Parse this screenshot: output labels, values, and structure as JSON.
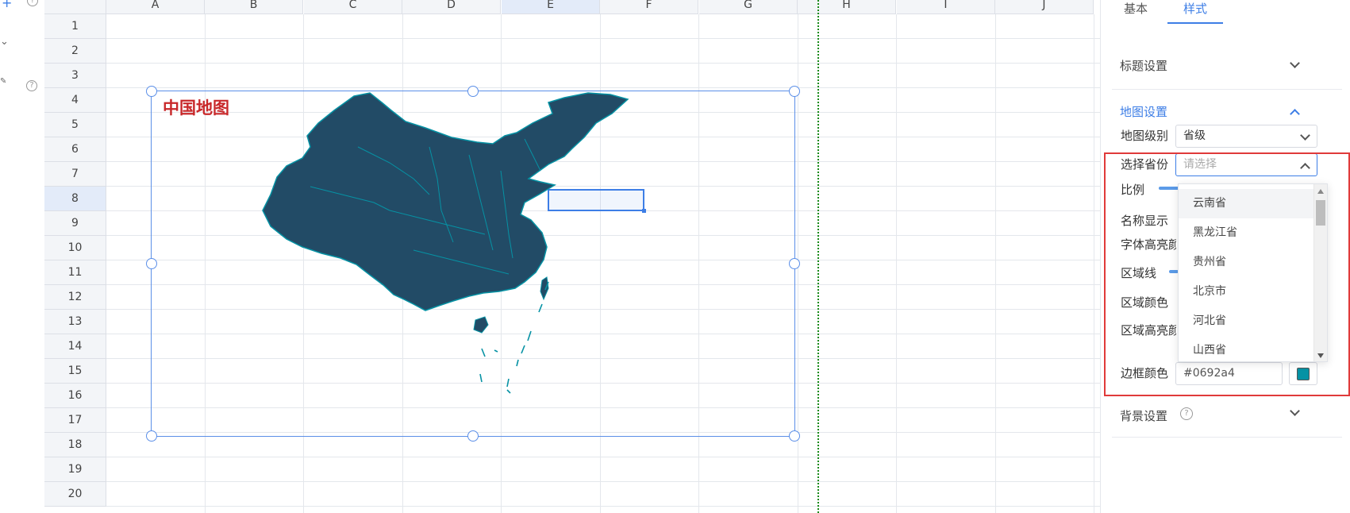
{
  "sheet": {
    "columns": [
      "A",
      "B",
      "C",
      "D",
      "E",
      "F",
      "G",
      "H",
      "I",
      "J"
    ],
    "rows": [
      "1",
      "2",
      "3",
      "4",
      "5",
      "6",
      "7",
      "8",
      "9",
      "10",
      "11",
      "12",
      "13",
      "14",
      "15",
      "16",
      "17",
      "18",
      "19",
      "20"
    ],
    "selected_column": "E",
    "selected_row": "8"
  },
  "chart": {
    "title": "中国地图",
    "fill_color": "#224b66",
    "border_color": "#0692a4"
  },
  "panel": {
    "tabs": [
      {
        "label": "基本",
        "active": false
      },
      {
        "label": "样式",
        "active": true
      }
    ],
    "sections": {
      "title_settings": "标题设置",
      "map_settings": "地图设置",
      "background_settings": "背景设置"
    },
    "fields": {
      "map_level_label": "地图级别",
      "map_level_value": "省级",
      "province_label": "选择省份",
      "province_placeholder": "请选择",
      "scale_label": "比例",
      "name_display_label": "名称显示",
      "font_highlight_label": "字体高亮颜",
      "region_line_label": "区域线",
      "region_color_label": "区域颜色",
      "region_highlight_label": "区域高亮颜",
      "border_color_label": "边框颜色",
      "border_color_value": "#0692a4"
    },
    "province_options": [
      "云南省",
      "黑龙江省",
      "贵州省",
      "北京市",
      "河北省",
      "山西省"
    ],
    "hovered_option": "云南省",
    "accent_color": "#3d7ee6",
    "highlight_box_color": "#e03a3a"
  },
  "icons": {
    "left_top": "plus-icon",
    "left_chevron": "chevron-down-icon",
    "left_pen": "pen-icon",
    "help": "question-icon"
  }
}
